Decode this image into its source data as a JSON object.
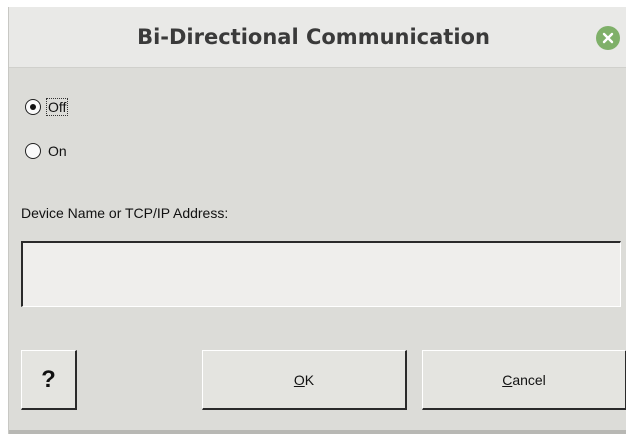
{
  "window": {
    "title": "Bi-Directional Communication",
    "close_icon": "close-icon",
    "close_color": "#7fb069"
  },
  "radio": {
    "off": {
      "label": "Off",
      "checked": true
    },
    "on": {
      "label": "On",
      "checked": false
    }
  },
  "device": {
    "label": "Device Name or TCP/IP Address:",
    "value": "",
    "placeholder": ""
  },
  "buttons": {
    "help_label": "?",
    "ok_mnemonic": "O",
    "ok_rest": "K",
    "cancel_mnemonic": "C",
    "cancel_rest": "ancel"
  }
}
